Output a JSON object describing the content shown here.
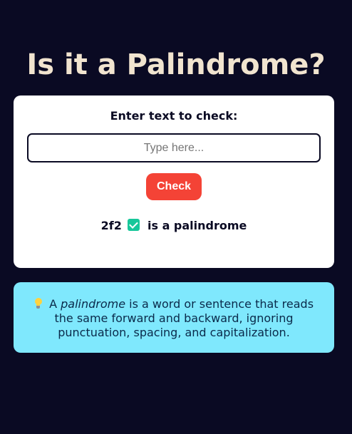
{
  "page": {
    "title": "Is it a Palindrome?"
  },
  "checker": {
    "label": "Enter text to check:",
    "input_value": "",
    "input_placeholder": "Type here...",
    "button_label": "Check",
    "result": {
      "word": "2f2",
      "icon": "check-mark-icon",
      "message": "is a palindrome"
    }
  },
  "info": {
    "icon": "lightbulb-icon",
    "prefix": "A",
    "term": "palindrome",
    "definition": "is a word or sentence that reads the same forward and backward, ignoring punctuation, spacing, and capitalization."
  },
  "colors": {
    "background": "#0a0a23",
    "title": "#f1e4cf",
    "card": "#ffffff",
    "button": "#f44336",
    "success": "#17c79a",
    "info_box": "#7fe8fd"
  }
}
